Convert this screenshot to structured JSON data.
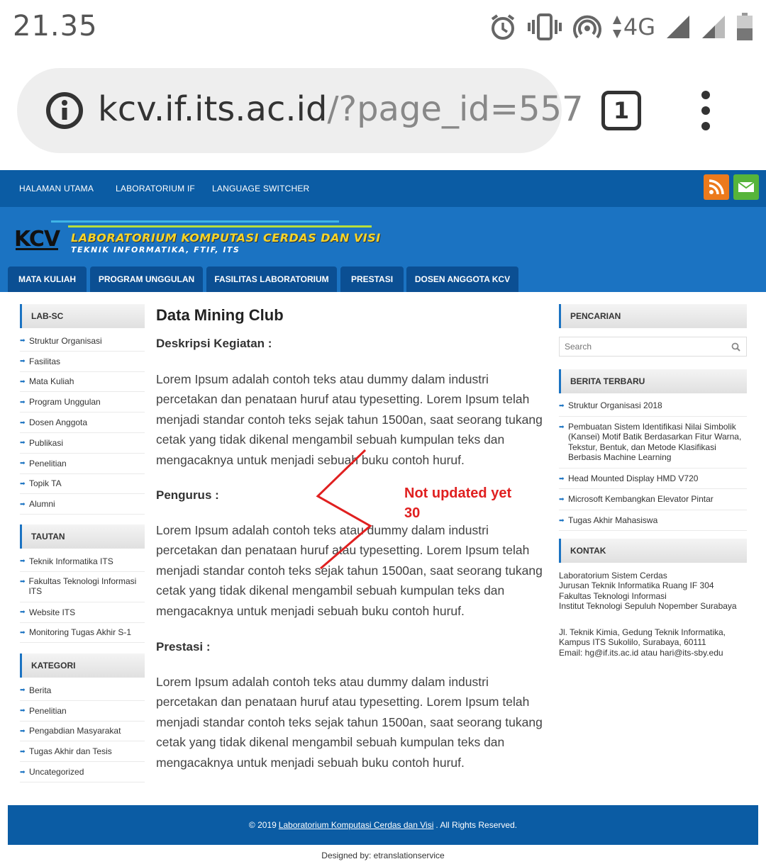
{
  "status_bar": {
    "time": "21.35",
    "network": "4G",
    "icons": [
      "alarm-icon",
      "vibrate-icon",
      "hotspot-icon",
      "data-arrows-icon",
      "signal-icon",
      "signal-icon",
      "battery-icon"
    ]
  },
  "browser": {
    "url_host": "kcv.if.its.ac.id",
    "url_path": "/?page_id=557",
    "tab_count": "1"
  },
  "top_nav": {
    "items": [
      "HALAMAN UTAMA",
      "LABORATORIUM IF",
      "LANGUAGE SWITCHER"
    ]
  },
  "header": {
    "logo_text": "KCV",
    "title": "LABORATORIUM KOMPUTASI CERDAS DAN VISI",
    "subtitle": "TEKNIK INFORMATIKA, FTIF, ITS"
  },
  "main_nav": {
    "items": [
      "MATA KULIAH",
      "PROGRAM UNGGULAN",
      "FASILITAS LABORATORIUM",
      "PRESTASI",
      "DOSEN ANGGOTA KCV"
    ]
  },
  "left_sidebar": {
    "lab_sc": {
      "title": "LAB-SC",
      "items": [
        "Struktur Organisasi",
        "Fasilitas",
        "Mata Kuliah",
        "Program Unggulan",
        "Dosen Anggota",
        "Publikasi",
        "Penelitian",
        "Topik TA",
        "Alumni"
      ]
    },
    "tautan": {
      "title": "TAUTAN",
      "items": [
        "Teknik Informatika ITS",
        "Fakultas Teknologi Informasi ITS",
        "Website ITS",
        "Monitoring Tugas Akhir S-1"
      ]
    },
    "kategori": {
      "title": "KATEGORI",
      "items": [
        "Berita",
        "Penelitian",
        "Pengabdian Masyarakat",
        "Tugas Akhir dan Tesis",
        "Uncategorized"
      ]
    }
  },
  "content": {
    "title": "Data Mining Club",
    "sections": [
      {
        "heading": "Deskripsi Kegiatan :",
        "text": "Lorem Ipsum adalah contoh teks atau dummy dalam industri percetakan dan penataan huruf atau typesetting. Lorem Ipsum telah menjadi standar contoh teks sejak tahun 1500an, saat seorang tukang cetak yang tidak dikenal mengambil sebuah kumpulan teks dan mengacaknya untuk menjadi sebuah buku contoh huruf."
      },
      {
        "heading": "Pengurus :",
        "text": "Lorem Ipsum adalah contoh teks atau dummy dalam industri percetakan dan penataan huruf atau typesetting. Lorem Ipsum telah menjadi standar contoh teks sejak tahun 1500an, saat seorang tukang cetak yang tidak dikenal mengambil sebuah kumpulan teks dan mengacaknya untuk menjadi sebuah buku contoh huruf."
      },
      {
        "heading": "Prestasi :",
        "text": "Lorem Ipsum adalah contoh teks atau dummy dalam industri percetakan dan penataan huruf atau typesetting. Lorem Ipsum telah menjadi standar contoh teks sejak tahun 1500an, saat seorang tukang cetak yang tidak dikenal mengambil sebuah kumpulan teks dan mengacaknya untuk menjadi sebuah buku contoh huruf."
      }
    ],
    "annotation_line1": "Not updated yet",
    "annotation_line2": "30"
  },
  "right_sidebar": {
    "search": {
      "title": "PENCARIAN",
      "placeholder": "Search"
    },
    "news": {
      "title": "BERITA TERBARU",
      "items": [
        "Struktur Organisasi 2018",
        "Pembuatan Sistem Identifikasi Nilai Simbolik (Kansei) Motif Batik Berdasarkan Fitur Warna, Tekstur, Bentuk, dan Metode Klasifikasi Berbasis Machine Learning",
        "Head Mounted Display HMD V720",
        "Microsoft Kembangkan Elevator Pintar",
        "Tugas Akhir Mahasiswa"
      ]
    },
    "contact": {
      "title": "KONTAK",
      "lines1": [
        "Laboratorium Sistem Cerdas",
        "Jurusan Teknik Informatika Ruang IF 304",
        "Fakultas Teknologi Informasi",
        "Institut Teknologi Sepuluh Nopember Surabaya"
      ],
      "lines2": [
        "Jl. Teknik Kimia, Gedung Teknik Informatika,",
        "Kampus ITS Sukolilo, Surabaya, 60111",
        "Email: hg@if.its.ac.id atau hari@its-sby.edu"
      ]
    }
  },
  "footer": {
    "prefix": "© 2019",
    "link": "Laboratorium Komputasi Cerdas dan Visi",
    "suffix": ". All Rights Reserved.",
    "designed_by": "Designed by: etranslationservice"
  },
  "colors": {
    "nav_blue": "#0b5ca4",
    "header_blue": "#1b73c2",
    "tab_blue": "#0b4f93",
    "annotation_red": "#e02020",
    "rss_orange": "#ec7a1c",
    "mail_green": "#56b43a"
  }
}
